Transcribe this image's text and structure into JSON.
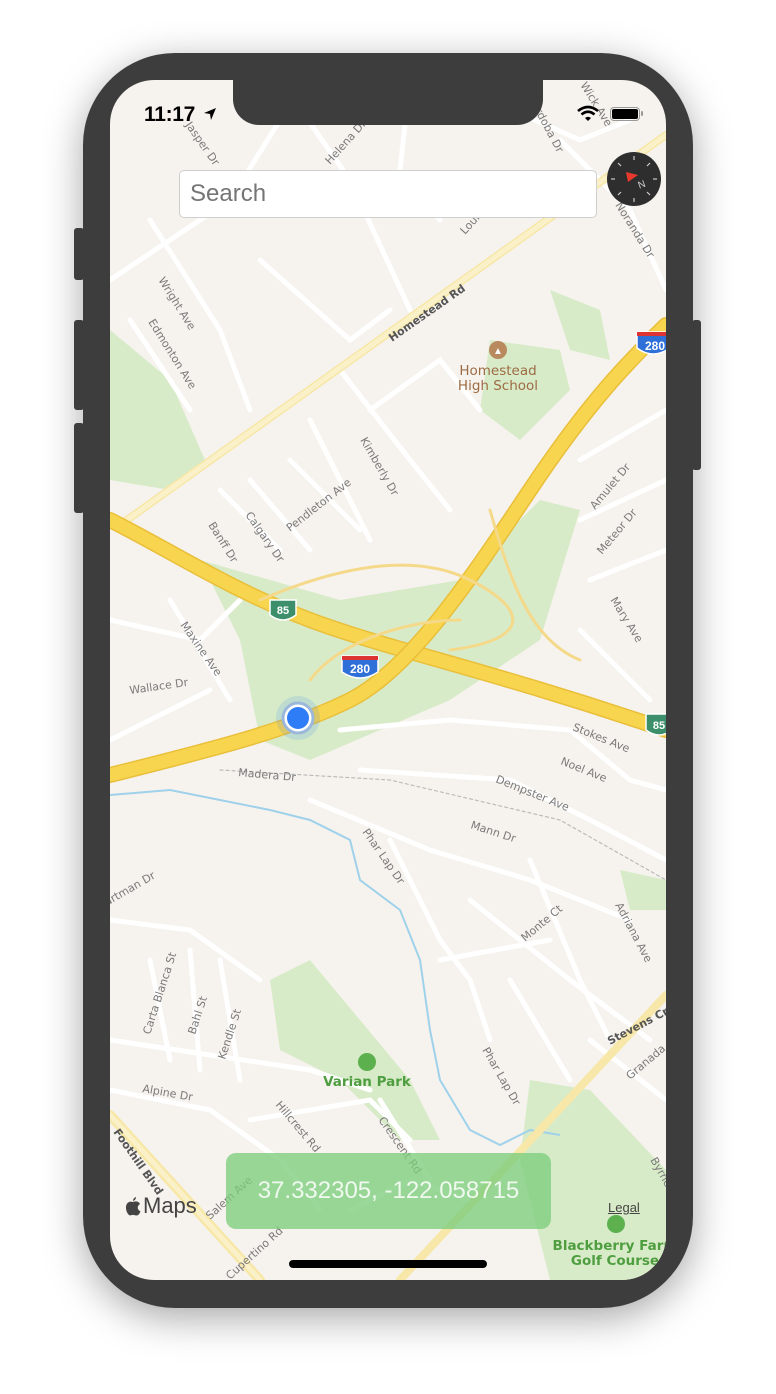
{
  "status_bar": {
    "time": "11:17",
    "location_icon": "location-arrow-icon",
    "wifi_icon": "wifi-icon",
    "battery_icon": "battery-icon"
  },
  "search": {
    "placeholder": "Search",
    "value": ""
  },
  "compass": {
    "icon": "compass-icon",
    "heading_label": "N",
    "needle_color": "#e8392c"
  },
  "coordinates": {
    "text": "37.332305, -122.058715",
    "background": "#7ccd7c"
  },
  "attribution": {
    "logo": "Maps",
    "legal": "Legal"
  },
  "map": {
    "colors": {
      "land": "#f6f3ee",
      "park": "#d4eac3",
      "freeway": "#f8d54f",
      "road": "#ffffff",
      "water": "#9fd1ea",
      "location_dot": "#2f7df6"
    },
    "shields": [
      "85",
      "280",
      "280",
      "85"
    ],
    "pois": [
      "Homestead\nHigh School",
      "Varian Park",
      "Blackberry Farm\nGolf Course"
    ],
    "poi_lines": {
      "homestead_1": "Homestead",
      "homestead_2": "High School",
      "varian": "Varian Park",
      "blackberry_1": "Blackberry Farm",
      "blackberry_2": "Golf Course"
    },
    "streets": [
      "Homestead Rd",
      "Wright Ave",
      "Edmonton Ave",
      "Kimberly Dr",
      "Pendleton Ave",
      "Calgary Dr",
      "Banff Dr",
      "Maxine Ave",
      "Wallace Dr",
      "Madera Dr",
      "Stokes Ave",
      "Noel Ave",
      "Dempster Ave",
      "Mann Dr",
      "Phar Lap Dr",
      "Monte Ct",
      "Adriana Ave",
      "Amulet Dr",
      "Meteor Dr",
      "Mary Ave",
      "Noranda Dr",
      "Carta Blanca St",
      "Bahl St",
      "Kendle St",
      "Alpine Dr",
      "Hillcrest Rd",
      "Crescent Rd",
      "Salem Ave",
      "Cupertino Rd",
      "Phar Lap Dr",
      "Stevens Creek Blvd",
      "Foothill Blvd",
      "Hartman Dr",
      "Jasper Dr",
      "Helena Dr",
      "Louise Dr",
      "Cordoba Dr",
      "Wick Ave",
      "Granada Ave",
      "Byrne Ave"
    ]
  }
}
